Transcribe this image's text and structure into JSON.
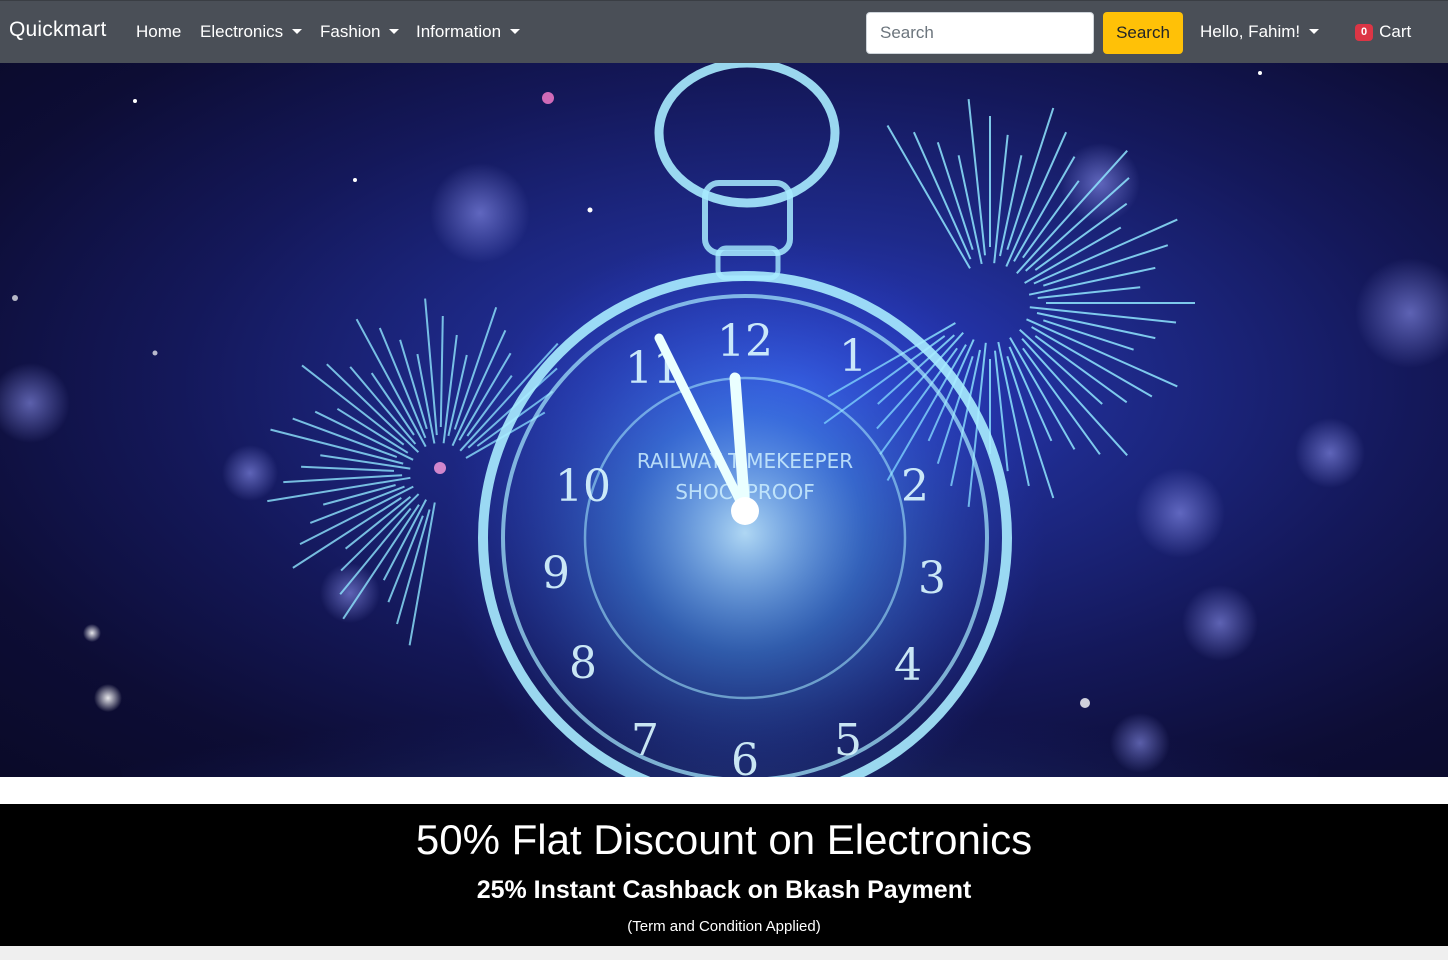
{
  "navbar": {
    "brand": "Quickmart",
    "links": {
      "home": "Home",
      "electronics": "Electronics",
      "fashion": "Fashion",
      "information": "Information"
    },
    "search": {
      "placeholder": "Search",
      "button_label": "Search"
    },
    "user_greeting": "Hello, Fahim!",
    "cart": {
      "count": "0",
      "label": "Cart"
    }
  },
  "hero": {
    "clock_numerals": [
      "12",
      "1",
      "2",
      "3",
      "4",
      "5",
      "6",
      "7",
      "8",
      "9",
      "10",
      "11"
    ],
    "dial_text_top": "RAILWAY TIMEKEEPER",
    "dial_text_mid": "SHOCKPROOF",
    "accent_colors": {
      "deep": "#0d0d35",
      "glow": "#7fd8ff",
      "mid": "#2a3fd0"
    }
  },
  "promo": {
    "title": "50% Flat Discount on Electronics",
    "subtitle": "25% Instant Cashback on Bkash Payment",
    "note": "(Term and Condition Applied)"
  }
}
